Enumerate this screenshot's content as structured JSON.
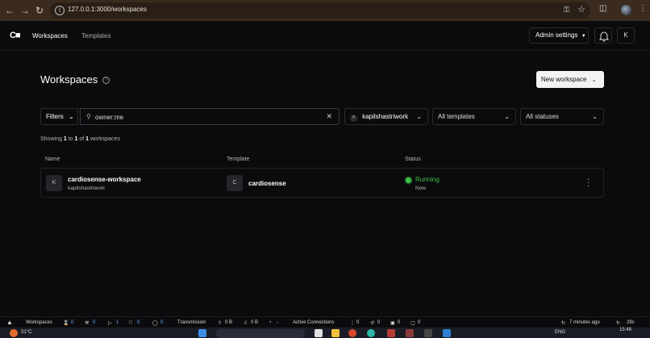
{
  "browser": {
    "url": "127.0.0.1:3000/workspaces",
    "back_icon": "arrow-left-icon",
    "forward_icon": "arrow-right-icon",
    "reload_icon": "reload-icon"
  },
  "header": {
    "logo": "C■",
    "nav": [
      "Workspaces",
      "Templates"
    ],
    "admin_label": "Admin settings",
    "user_initial": "K"
  },
  "page": {
    "title": "Workspaces",
    "new_workspace_label": "New workspace"
  },
  "filters": {
    "filters_label": "Filters",
    "search_value": "owner:me",
    "owner_value": "kapilshastriwork",
    "templates_value": "All templates",
    "statuses_value": "All statuses"
  },
  "showing": {
    "prefix": "Showing",
    "from": "1",
    "to_word": "to",
    "to": "1",
    "of_word": "of",
    "total": "1",
    "suffix": "workspaces"
  },
  "table": {
    "headers": [
      "Name",
      "Template",
      "Status"
    ],
    "rows": [
      {
        "avatar": "K",
        "name": "cardiosense-workspace",
        "owner": "kapilshastriwork",
        "template_avatar": "C",
        "template": "cardiosense",
        "status": "Running",
        "status_time": "Now",
        "status_color": "#3fbf46"
      }
    ]
  },
  "statusbar": {
    "workspaces_label": "Workspaces",
    "counts": [
      "0",
      "0",
      "1",
      "0",
      "0"
    ],
    "transmission_label": "Transmission",
    "transmission_values": [
      "0 B",
      "0 B"
    ],
    "transmission_dash": "-",
    "active_label": "Active Connections",
    "active_values": [
      "0",
      "0",
      "0",
      "0"
    ],
    "last_updated": "7 minutes ago",
    "refresh": "29s"
  },
  "taskbar": {
    "weather": "31°C",
    "lang": "ENG",
    "time": "15:48"
  }
}
